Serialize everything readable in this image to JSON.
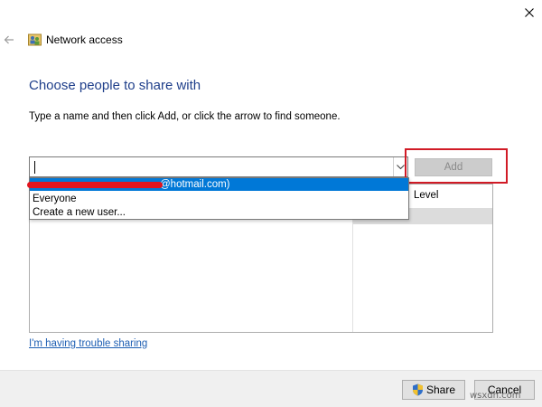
{
  "window": {
    "title": "Network access",
    "close_icon": "close-icon",
    "back_icon": "back-arrow-icon",
    "app_icon": "network-users-icon"
  },
  "main": {
    "heading": "Choose people to share with",
    "instruction": "Type a name and then click Add, or click the arrow to find someone."
  },
  "name_input": {
    "value": "",
    "dropdown_icon": "chevron-down-icon"
  },
  "add_button": {
    "label": "Add",
    "enabled": false
  },
  "dropdown": {
    "options": [
      {
        "label": "@hotmail.com)",
        "highlighted": true
      },
      {
        "label": "Everyone",
        "highlighted": false
      },
      {
        "label": "Create a new user...",
        "highlighted": false
      }
    ]
  },
  "share_list": {
    "columns": [
      "Level"
    ]
  },
  "trouble_link": "I'm having trouble sharing",
  "footer": {
    "share_label": "Share",
    "share_icon": "uac-shield-icon",
    "cancel_label": "Cancel"
  },
  "watermark": "wsxdn.com",
  "colors": {
    "heading": "#1e3e8a",
    "highlight": "#0078d7",
    "annotation": "#d11b26",
    "link": "#1e5fb3"
  }
}
